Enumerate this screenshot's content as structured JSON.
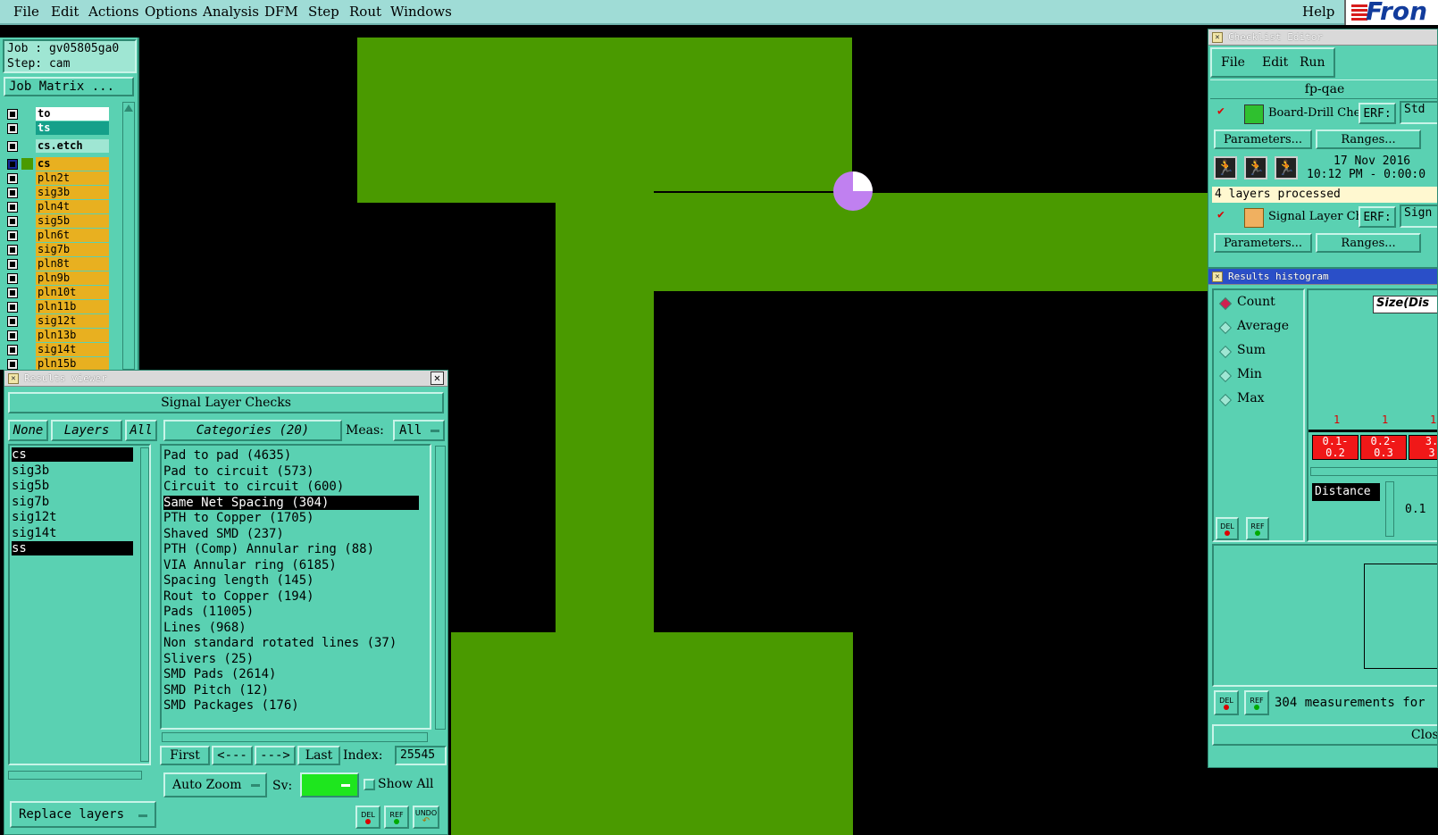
{
  "menu": [
    "File",
    "Edit",
    "Actions",
    "Options",
    "Analysis",
    "DFM",
    "Step",
    "Rout",
    "Windows"
  ],
  "help": "Help",
  "logo_text": "Fron",
  "job": {
    "label": "Job : gv05805ga0",
    "step": "Step: cam",
    "matrix_button": "Job Matrix ..."
  },
  "layers": [
    {
      "name": "to",
      "color": "#ffffff"
    },
    {
      "name": "ts",
      "color": "#15a08a"
    },
    {
      "name": "cs.etch",
      "color": "#9fe6d3"
    },
    {
      "name": "cs",
      "color": "#e8b020"
    },
    {
      "name": "pln2t",
      "color": "#e8b020"
    },
    {
      "name": "sig3b",
      "color": "#e8b020"
    },
    {
      "name": "pln4t",
      "color": "#e8b020"
    },
    {
      "name": "sig5b",
      "color": "#e8b020"
    },
    {
      "name": "pln6t",
      "color": "#e8b020"
    },
    {
      "name": "sig7b",
      "color": "#e8b020"
    },
    {
      "name": "pln8t",
      "color": "#e8b020"
    },
    {
      "name": "pln9b",
      "color": "#e8b020"
    },
    {
      "name": "pln10t",
      "color": "#e8b020"
    },
    {
      "name": "pln11b",
      "color": "#e8b020"
    },
    {
      "name": "sig12t",
      "color": "#e8b020"
    },
    {
      "name": "pln13b",
      "color": "#e8b020"
    },
    {
      "name": "sig14t",
      "color": "#e8b020"
    },
    {
      "name": "pln15b",
      "color": "#e8b020"
    }
  ],
  "results_viewer": {
    "title": "Results viewer",
    "check_name": "Signal Layer Checks",
    "none": "None",
    "layers": "Layers",
    "all": "All",
    "categories_label": "Categories (20)",
    "meas_label": "Meas:",
    "meas_value": "All",
    "layer_list": [
      "cs",
      "sig3b",
      "sig5b",
      "sig7b",
      "sig12t",
      "sig14t",
      "ss"
    ],
    "categories": [
      "Pad to pad (4635)",
      "Pad to circuit (573)",
      "Circuit to circuit (600)",
      "Same Net Spacing (304)",
      "PTH to Copper (1705)",
      "Shaved SMD (237)",
      "PTH (Comp) Annular ring (88)",
      "VIA Annular ring (6185)",
      "Spacing length (145)",
      "Rout to Copper (194)",
      "Pads (11005)",
      "Lines (968)",
      "Non standard rotated lines (37)",
      "Slivers (25)",
      "SMD Pads (2614)",
      "SMD Pitch (12)",
      "SMD Packages (176)"
    ],
    "selected_category": 3,
    "first": "First",
    "prev": "<---",
    "next": "--->",
    "last": "Last",
    "index_label": "Index:",
    "index_value": "25545",
    "auto_zoom": "Auto Zoom",
    "sv_label": "Sv:",
    "show_all": "Show All",
    "replace_layers": "Replace layers",
    "del": "DEL",
    "ref": "REF",
    "undo": "UNDO"
  },
  "checklist": {
    "title": "Checklist Editor",
    "menu": [
      "File",
      "Edit",
      "Run"
    ],
    "name": "fp-qae",
    "check1": "Board-Drill Che",
    "erf": "ERF:",
    "std": "Std",
    "parameters": "Parameters...",
    "ranges": "Ranges...",
    "date": "17 Nov 2016",
    "time": "10:12 PM - 0:00:0",
    "status": "4 layers processed",
    "check2": "Signal Layer Ch",
    "sig": "Sign"
  },
  "histogram": {
    "title": "Results histogram",
    "options": [
      "Count",
      "Average",
      "Sum",
      "Min",
      "Max"
    ],
    "selected": 0,
    "axis_label": "Size(Dis",
    "counts": [
      "1",
      "1",
      "1"
    ],
    "bins": [
      "0.1-\n0.2",
      "0.2-\n0.3",
      "3.\n3"
    ],
    "distance": "Distance",
    "distance_value": "0.1",
    "measurements": "304 measurements for",
    "close": "Close",
    "del": "DEL",
    "ref": "REF"
  },
  "colors": {
    "copper": "#4a9a00",
    "panel": "#5ad1b2",
    "menubar": "#9fdcd6",
    "highlight": "#c080f0"
  }
}
